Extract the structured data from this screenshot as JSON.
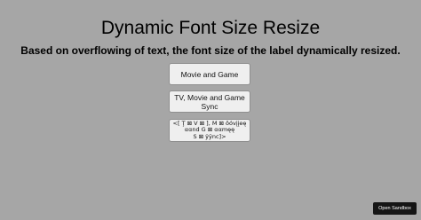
{
  "header": {
    "title": "Dynamic Font Size Resize",
    "subtitle": "Based on overflowing of text, the font size of the label dynamically resized."
  },
  "buttons": [
    {
      "label": "Movie and Game"
    },
    {
      "label": "TV, Movie and Game Sync"
    },
    {
      "label": "<[ Ţ ⊠ V ⊠ ], M ⊠ ôóvįįeę\nααnd G ⊠ ααmęę\nS ⊠ ŷÿnc]>"
    }
  ],
  "footer": {
    "sandbox_label": "Open Sandbox"
  },
  "colors": {
    "background": "#a6a6a6",
    "button_background": "#efefef",
    "sandbox_background": "#151515",
    "sandbox_text": "#ffffff"
  }
}
